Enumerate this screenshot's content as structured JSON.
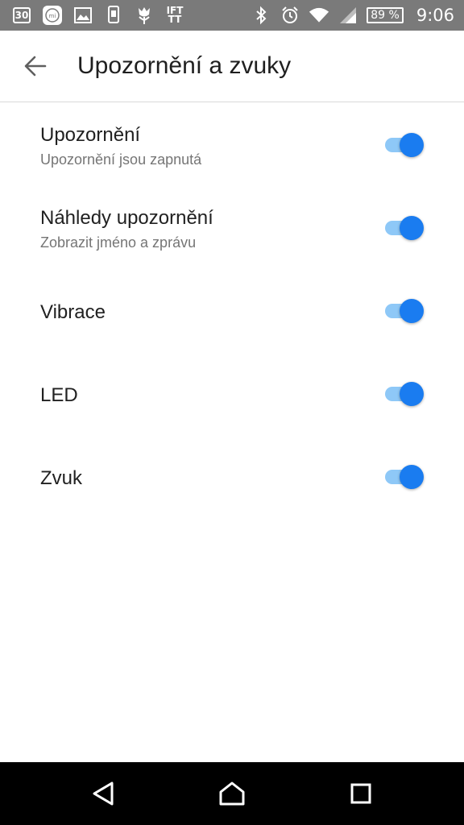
{
  "status_bar": {
    "notification_icons": [
      "calendar-icon",
      "mi-app-icon",
      "image-icon",
      "phone-icon",
      "tulip-icon",
      "ifttt-icon"
    ],
    "calendar_day": "30",
    "ifttt_text_top": "IFT",
    "ifttt_text_bottom": "TT",
    "battery_percent": "89 %",
    "time": "9:06"
  },
  "app_bar": {
    "back_icon": "arrow-back-icon",
    "title": "Upozornění a zvuky"
  },
  "settings": [
    {
      "title": "Upozornění",
      "subtitle": "Upozornění jsou zapnutá",
      "enabled": true
    },
    {
      "title": "Náhledy upozornění",
      "subtitle": "Zobrazit jméno a zprávu",
      "enabled": true
    },
    {
      "title": "Vibrace",
      "subtitle": "",
      "enabled": true
    },
    {
      "title": "LED",
      "subtitle": "",
      "enabled": true
    },
    {
      "title": "Zvuk",
      "subtitle": "",
      "enabled": true
    }
  ],
  "colors": {
    "accent": "#1a7cf0",
    "accent_track": "#8ec8f7",
    "status_bar": "#7a7a7a",
    "nav_bar": "#000000"
  },
  "nav_bar": {
    "buttons": [
      "nav-back-icon",
      "nav-home-icon",
      "nav-recents-icon"
    ]
  }
}
